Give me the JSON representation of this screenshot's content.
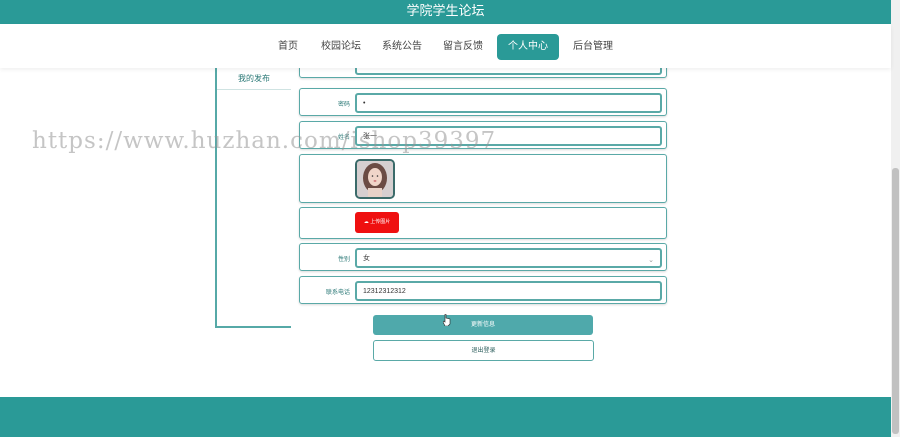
{
  "header": {
    "title": "学院学生论坛"
  },
  "nav": {
    "items": [
      "首页",
      "校园论坛",
      "系统公告",
      "留言反馈",
      "个人中心",
      "后台管理"
    ],
    "active": "个人中心"
  },
  "sidebar": {
    "items": [
      "我的发布"
    ]
  },
  "form": {
    "password": {
      "label": "密码",
      "value": "•"
    },
    "name": {
      "label": "姓名",
      "value": "张一"
    },
    "upload_label": "上传图片",
    "gender": {
      "label": "性别",
      "value": "女"
    },
    "phone": {
      "label": "联系电话",
      "value": "12312312312"
    }
  },
  "buttons": {
    "update": "更新信息",
    "logout": "退出登录"
  },
  "watermark": "https://www.huzhan.com/ishop39397",
  "colors": {
    "teal": "#2a9a97",
    "upload_red": "#ef1010"
  }
}
